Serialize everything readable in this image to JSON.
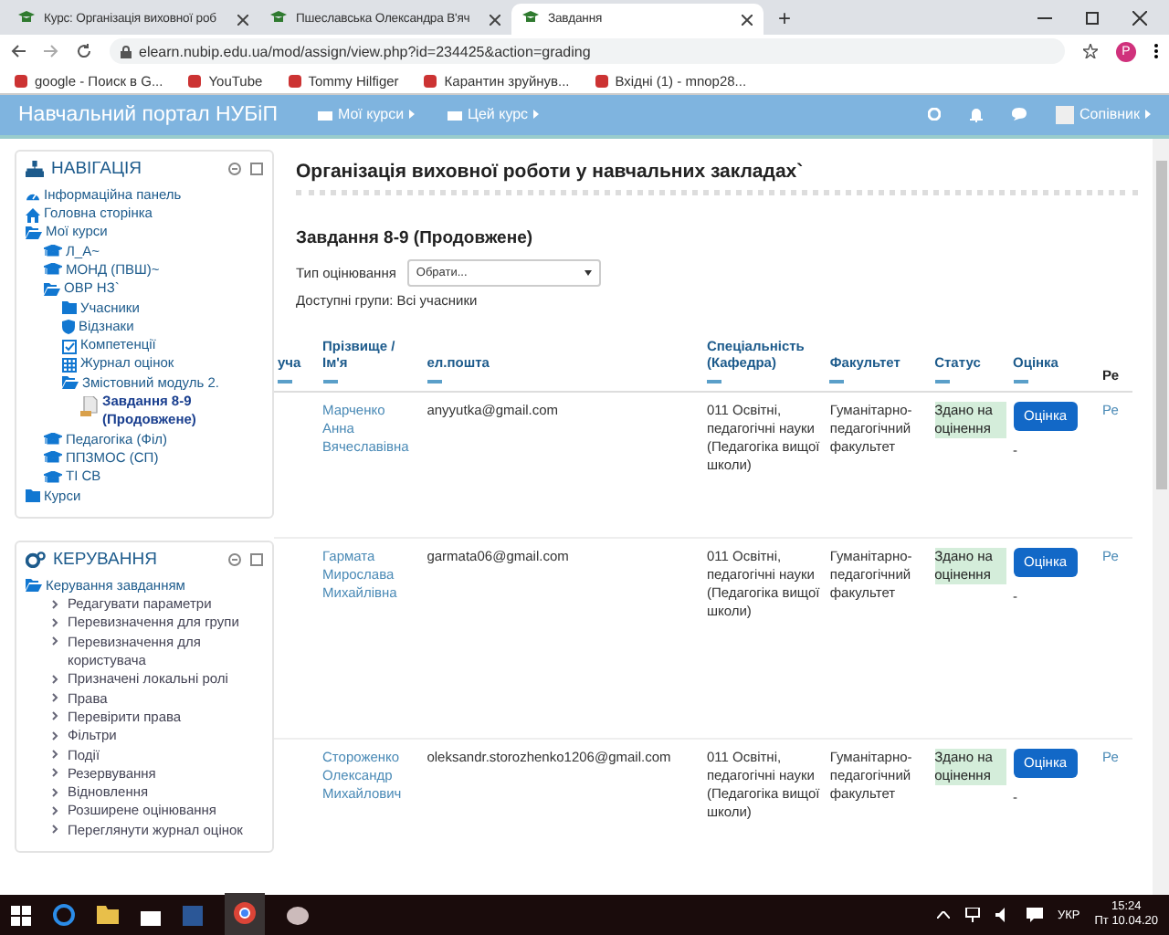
{
  "browser": {
    "tabs": [
      {
        "title": "Курс: Організація виховної роб",
        "selected": false
      },
      {
        "title": "Пшеславська Олександра В'яч",
        "selected": false
      },
      {
        "title": "Завдання",
        "selected": true
      }
    ],
    "address": "elearn.nubip.edu.ua/mod/assign/view.php?id=234425&action=grading",
    "new_tab": "+",
    "profile_initial": "P",
    "bookmarks": [
      "google - Поиск в G...",
      "YouTube",
      "Tommy Hilfiger",
      "Карантин зруйнув...",
      "Вхідні (1) - mnop28..."
    ]
  },
  "navbar": {
    "site_name": "Навчальний портал НУБіП",
    "menus": [
      "Мої курси",
      "Цей курс"
    ],
    "user": "Сопівник"
  },
  "navigation": {
    "title": "НАВІГАЦІЯ",
    "items": [
      {
        "label": "Інформаційна панель",
        "kind": "dashboard",
        "selected": false
      },
      {
        "label": "Головна сторінка",
        "kind": "home",
        "selected": false
      },
      {
        "label": "Мої курси",
        "kind": "folder-open",
        "selected": false,
        "children": [
          {
            "label": "Л_А~",
            "kind": "course",
            "selected": false
          },
          {
            "label": "МОНД (ПВШ)~",
            "kind": "course",
            "selected": false
          },
          {
            "label": "ОВР НЗ`",
            "kind": "folder-open",
            "selected": false,
            "children": [
              {
                "label": "Учасники",
                "kind": "folder",
                "selected": false
              },
              {
                "label": "Відзнаки",
                "kind": "shield",
                "selected": false
              },
              {
                "label": "Компетенції",
                "kind": "check",
                "selected": false
              },
              {
                "label": "Журнал оцінок",
                "kind": "grid",
                "selected": false
              },
              {
                "label": "Змістовний модуль 2.",
                "kind": "folder-open",
                "selected": false,
                "children": [
                  {
                    "label": "Завдання 8-9 (Продовжене)",
                    "kind": "file",
                    "selected": true
                  }
                ]
              }
            ]
          },
          {
            "label": "Педагогіка (Філ)",
            "kind": "course",
            "selected": false
          },
          {
            "label": "ППЗМОС (СП)",
            "kind": "course",
            "selected": false
          },
          {
            "label": "ТІ СВ",
            "kind": "course",
            "selected": false
          }
        ]
      },
      {
        "label": "Курси",
        "kind": "folder",
        "selected": false
      }
    ]
  },
  "administration": {
    "title": "КЕРУВАННЯ",
    "items": [
      {
        "label": "Керування завданням",
        "kind": "folder-open",
        "selected": false,
        "children": [
          {
            "label": "Редагувати параметри",
            "kind": "link",
            "selected": false
          },
          {
            "label": "Перевизначення для групи",
            "kind": "link",
            "selected": false
          },
          {
            "label": "Перевизначення для користувача",
            "kind": "link",
            "selected": false
          },
          {
            "label": "Призначені локальні ролі",
            "kind": "link",
            "selected": false
          },
          {
            "label": "Права",
            "kind": "link",
            "selected": false
          },
          {
            "label": "Перевірити права",
            "kind": "link",
            "selected": false
          },
          {
            "label": "Фільтри",
            "kind": "link",
            "selected": false
          },
          {
            "label": "Події",
            "kind": "link",
            "selected": false
          },
          {
            "label": "Резервування",
            "kind": "link",
            "selected": false
          },
          {
            "label": "Відновлення",
            "kind": "link",
            "selected": false
          },
          {
            "label": "Розширене оцінювання",
            "kind": "link",
            "selected": false
          },
          {
            "label": "Переглянути журнал оцінок",
            "kind": "link",
            "selected": false
          }
        ]
      }
    ]
  },
  "main": {
    "course_title": "Організація виховної роботи у навчальних закладах`",
    "assignment_title": "Завдання 8-9 (Продовжене)",
    "grading_type": {
      "label": "Тип оцінювання",
      "value": "Обрати..."
    },
    "groups": "Доступні групи: Всі учасники",
    "table": {
      "columns": [
        {
          "label": "уча",
          "kind": "link"
        },
        {
          "label": "Прізвище / Ім'я",
          "kind": "link"
        },
        {
          "label": "ел.пошта",
          "kind": "link"
        },
        {
          "label": "Спеціальність (Кафедра)",
          "kind": "link"
        },
        {
          "label": "Факультет",
          "kind": "link"
        },
        {
          "label": "Статус",
          "kind": "link"
        },
        {
          "label": "Оцінка",
          "kind": "link"
        },
        {
          "label": "Ре",
          "kind": "plain"
        }
      ],
      "rows": [
        {
          "name": "Марченко Анна Вячеславівна",
          "email": "anyyutka@gmail.com",
          "specialty": "011 Освітні, педагогічні науки (Педагогіка вищої школи)",
          "faculty": "Гуманітарно-педагогічний факультет",
          "status": "Здано на оцінення",
          "grade_button": "Оцінка",
          "grade": "-",
          "column_8": "Ре"
        },
        {
          "name": "Гармата Мирослава Михайлівна",
          "email": "garmata06@gmail.com",
          "specialty": "011 Освітні, педагогічні науки (Педагогіка вищої школи)",
          "faculty": "Гуманітарно-педагогічний факультет",
          "status": "Здано на оцінення",
          "grade_button": "Оцінка",
          "grade": "-",
          "column_8": "Ре"
        },
        {
          "name": "Стороженко Олександр Михайлович",
          "email": "oleksandr.storozhenko1206@gmail.com",
          "specialty": "011 Освітні, педагогічні науки (Педагогіка вищої школи)",
          "faculty": "Гуманітарно-педагогічний факультет",
          "status": "Здано на оцінення",
          "grade_button": "Оцінка",
          "grade": "-",
          "column_8": "Ре"
        }
      ]
    }
  },
  "taskbar": {
    "language": "УКР",
    "time": "15:24",
    "date": "Пт 10.04.20"
  }
}
